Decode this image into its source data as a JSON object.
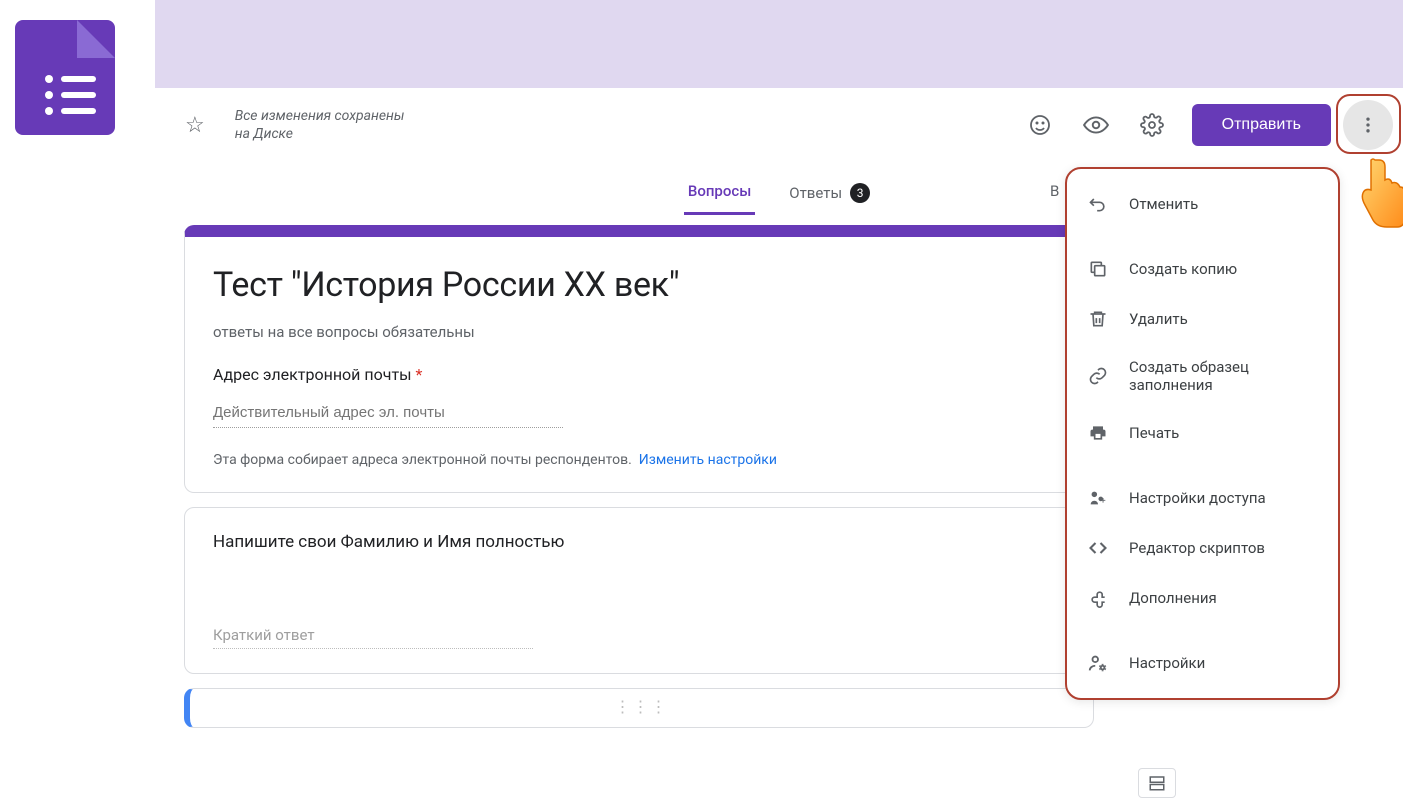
{
  "header": {
    "save_status": "Все изменения сохранены\nна Диске",
    "send_button": "Отправить"
  },
  "tabs": {
    "questions": "Вопросы",
    "responses": "Ответы",
    "responses_count": "3",
    "truncated": "В"
  },
  "form": {
    "title": "Тест \"История России XX век\"",
    "description": "ответы на все вопросы обязательны",
    "email_label": "Адрес электронной почты",
    "email_placeholder": "Действительный адрес эл. почты",
    "email_note": "Эта форма собирает адреса электронной почты респондентов.",
    "email_settings_link": "Изменить настройки"
  },
  "question1": {
    "text": "Напишите свои Фамилию и Имя полностью",
    "answer_placeholder": "Краткий ответ"
  },
  "menu": {
    "items": [
      {
        "icon": "undo",
        "label": "Отменить"
      },
      {
        "icon": "copy",
        "label": "Создать копию"
      },
      {
        "icon": "trash",
        "label": "Удалить"
      },
      {
        "icon": "link",
        "label": "Создать образец заполнения"
      },
      {
        "icon": "print",
        "label": "Печать"
      },
      {
        "icon": "share",
        "label": "Настройки доступа"
      },
      {
        "icon": "code",
        "label": "Редактор скриптов"
      },
      {
        "icon": "addon",
        "label": "Дополнения"
      },
      {
        "icon": "settings",
        "label": "Настройки"
      }
    ]
  },
  "colors": {
    "primary": "#673ab7",
    "highlight_border": "#b04030"
  }
}
